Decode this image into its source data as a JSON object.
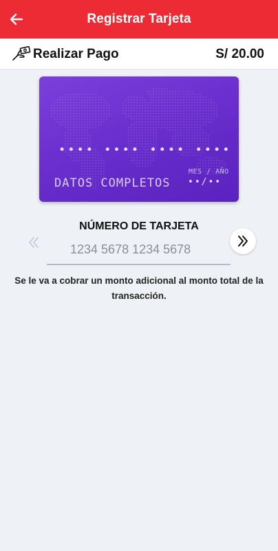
{
  "header": {
    "title": "Registrar Tarjeta",
    "back_icon": "arrow-left-icon",
    "color": "#ec2b34"
  },
  "payment": {
    "label": "Realizar Pago",
    "amount": "S/ 20.00",
    "icon": "hand-money-icon"
  },
  "card": {
    "number_mask": "•••• •••• •••• ••••",
    "holder_placeholder": "DATOS COMPLETOS",
    "expiry_label": "MES / AÑO",
    "expiry_value": "••/••",
    "color": "#6a2fce"
  },
  "form": {
    "field_title": "NÚMERO DE TARJETA",
    "card_number_placeholder": "1234 5678 1234 5678",
    "prev_icon": "double-chevron-left-icon",
    "next_icon": "double-chevron-right-icon"
  },
  "notice": "Se le va a cobrar un monto adicional al monto total de la transacción."
}
